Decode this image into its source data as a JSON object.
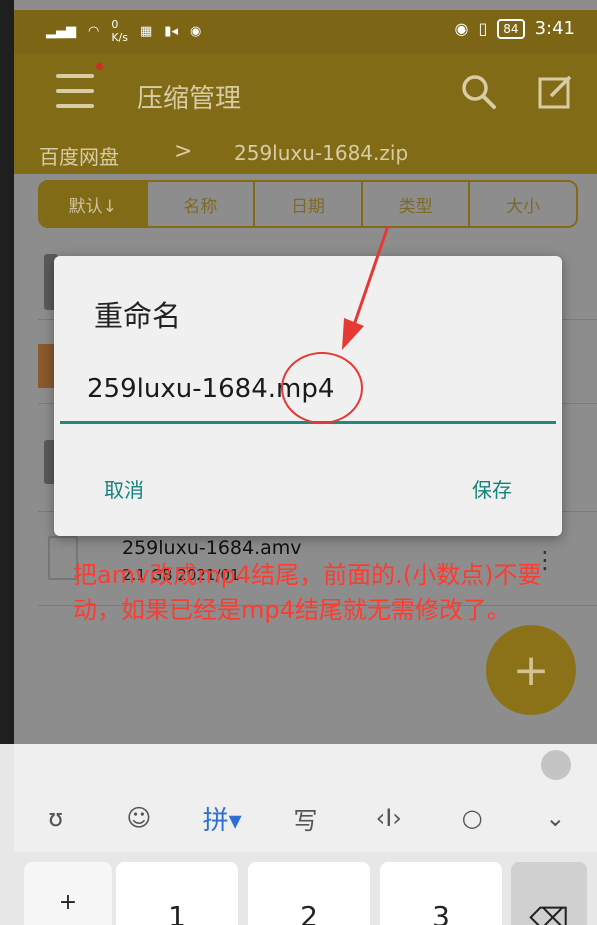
{
  "status_bar": {
    "net_speed_value": "0",
    "net_speed_unit": "K/s",
    "battery": "84",
    "time": "3:41"
  },
  "toolbar": {
    "title": "压缩管理"
  },
  "breadcrumb": {
    "root": "百度网盘",
    "separator": ">",
    "current": "259luxu-1684.zip"
  },
  "sort_tabs": [
    {
      "label": "默认↓"
    },
    {
      "label": "名称"
    },
    {
      "label": "日期"
    },
    {
      "label": "类型"
    },
    {
      "label": "大小"
    }
  ],
  "file_item": {
    "name": "259luxu-1684.amv",
    "meta": "2.1 GB  2021/01",
    "more": "⋮"
  },
  "dialog": {
    "title": "重命名",
    "input_value": "259luxu-1684.mp4",
    "cancel_label": "取消",
    "save_label": "保存"
  },
  "annotation": {
    "note": "把amv改成mp4结尾，前面的.(小数点)不要动，如果已经是mp4结尾就无需修改了。",
    "color": "#ff3b30"
  },
  "fab": {
    "label": "+"
  },
  "keyboard": {
    "tools": [
      {
        "icon": "du-bear-icon",
        "glyph": "ʊ"
      },
      {
        "icon": "emoji-icon",
        "glyph": "☺"
      },
      {
        "icon": "pinyin-icon",
        "glyph": "拼▾"
      },
      {
        "icon": "handwrite-icon",
        "glyph": "写"
      },
      {
        "icon": "cursor-icon",
        "glyph": "‹I›"
      },
      {
        "icon": "search-icon",
        "glyph": "○"
      },
      {
        "icon": "collapse-icon",
        "glyph": "⌄"
      }
    ],
    "keys": [
      "+",
      "1",
      "2",
      "3",
      "⌫"
    ]
  },
  "colors": {
    "accent": "#1e8a7f",
    "toolbar": "#826b17",
    "annotation": "#e53935"
  }
}
